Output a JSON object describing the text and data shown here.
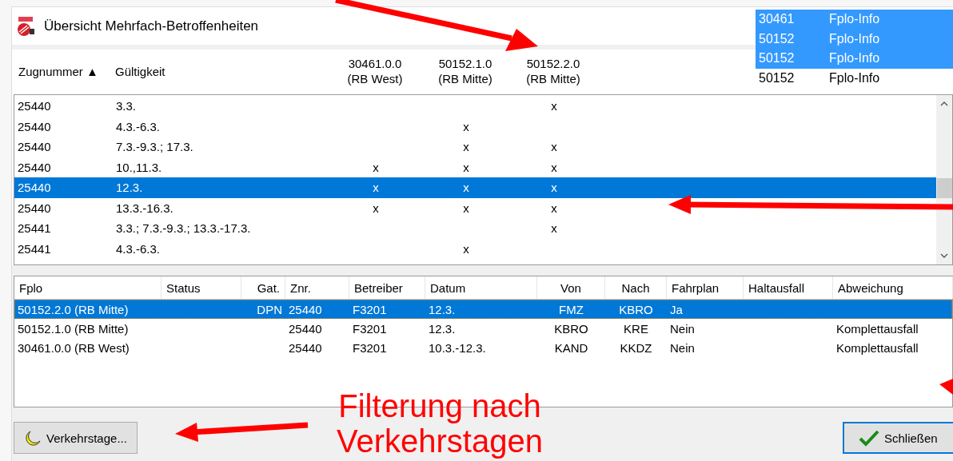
{
  "window": {
    "title": "Übersicht Mehrfach-Betroffenheiten"
  },
  "overview": {
    "columns": [
      {
        "lines": [
          "Zugnummer ▲"
        ]
      },
      {
        "lines": [
          "Gültigkeit"
        ]
      },
      {
        "lines": [
          "30461.0.0",
          "(RB West)"
        ]
      },
      {
        "lines": [
          "50152.1.0",
          "(RB Mitte)"
        ]
      },
      {
        "lines": [
          "50152.2.0",
          "(RB Mitte)"
        ]
      }
    ],
    "rows": [
      {
        "zugnummer": "25440",
        "gueltigkeit": "3.3.",
        "col_5": "x",
        "selected": false
      },
      {
        "zugnummer": "25440",
        "gueltigkeit": "4.3.-6.3.",
        "col_4": "x",
        "selected": false
      },
      {
        "zugnummer": "25440",
        "gueltigkeit": "7.3.-9.3.; 17.3.",
        "col_4": "x",
        "col_5": "x",
        "selected": false
      },
      {
        "zugnummer": "25440",
        "gueltigkeit": "10.,11.3.",
        "col_3": "x",
        "col_4": "x",
        "col_5": "x",
        "selected": false
      },
      {
        "zugnummer": "25440",
        "gueltigkeit": "12.3.",
        "col_3": "x",
        "col_4": "x",
        "col_5": "x",
        "selected": true
      },
      {
        "zugnummer": "25440",
        "gueltigkeit": "13.3.-16.3.",
        "col_3": "x",
        "col_4": "x",
        "col_5": "x",
        "selected": false
      },
      {
        "zugnummer": "25441",
        "gueltigkeit": "3.3.; 7.3.-9.3.; 13.3.-17.3.",
        "col_5": "x",
        "selected": false
      },
      {
        "zugnummer": "25441",
        "gueltigkeit": "4.3.-6.3.",
        "col_4": "x",
        "selected": false
      }
    ]
  },
  "details": {
    "columns": [
      "Fplo",
      "Status",
      "Gat.",
      "Znr.",
      "Betreiber",
      "Datum",
      "Von",
      "Nach",
      "Fahrplan",
      "Haltausfall",
      "Abweichung"
    ],
    "rows": [
      {
        "fplo": "50152.2.0 (RB Mitte)",
        "gat": "DPN",
        "znr": "25440",
        "betreiber": "F3201",
        "datum": "12.3.",
        "von": "FMZ",
        "nach": "KBRO",
        "fahrplan": "Ja",
        "selected": true
      },
      {
        "fplo": "50152.1.0 (RB Mitte)",
        "znr": "25440",
        "betreiber": "F3201",
        "datum": "12.3.",
        "von": "KBRO",
        "nach": "KRE",
        "fahrplan": "Nein",
        "abweichung": "Komplettausfall",
        "selected": false
      },
      {
        "fplo": "30461.0.0 (RB West)",
        "znr": "25440",
        "betreiber": "F3201",
        "datum": "10.3.-12.3.",
        "von": "KAND",
        "nach": "KKDZ",
        "fahrplan": "Nein",
        "abweichung": "Komplettausfall",
        "selected": false
      }
    ]
  },
  "buttons": {
    "filter": "Verkehrstage...",
    "close": "Schließen"
  },
  "popup_list": [
    {
      "number": "30461",
      "label": "Fplo-Info",
      "selected": true
    },
    {
      "number": "50152",
      "label": "Fplo-Info",
      "selected": true
    },
    {
      "number": "50152",
      "label": "Fplo-Info",
      "selected": true
    },
    {
      "number": "50152",
      "label": "Fplo-Info",
      "selected": false
    }
  ],
  "annotation": {
    "text": "Filterung nach Verkehrstagen"
  }
}
